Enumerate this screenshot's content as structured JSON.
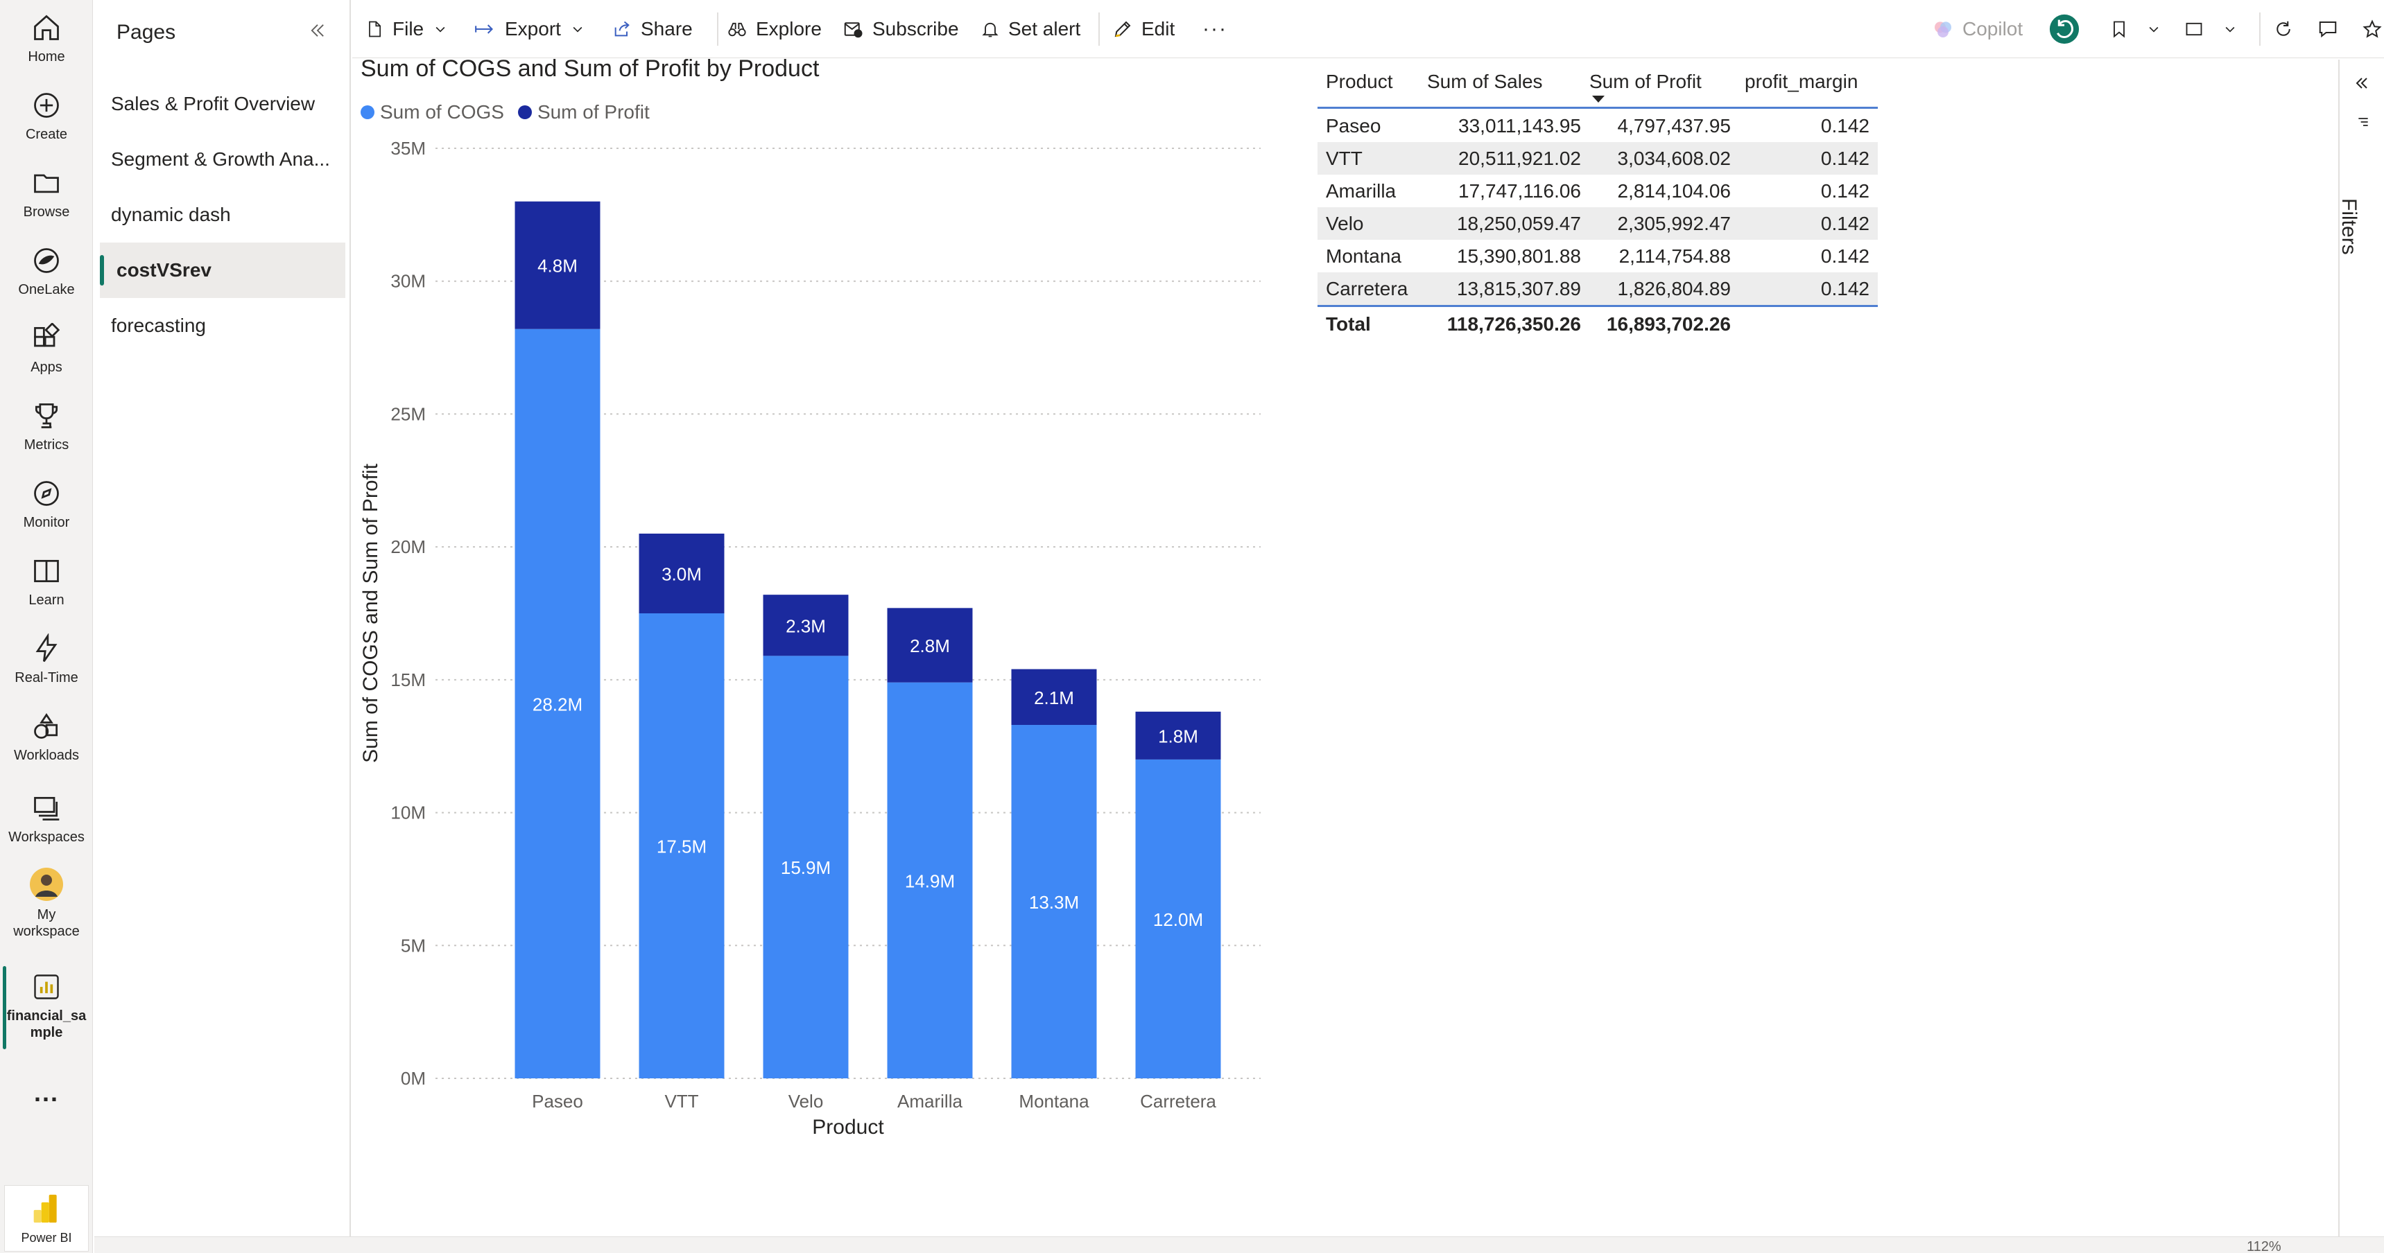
{
  "nav_rail": {
    "items": [
      {
        "label": "Home",
        "icon": "home-icon"
      },
      {
        "label": "Create",
        "icon": "create-icon"
      },
      {
        "label": "Browse",
        "icon": "folder-icon"
      },
      {
        "label": "OneLake",
        "icon": "onelake-icon"
      },
      {
        "label": "Apps",
        "icon": "apps-icon"
      },
      {
        "label": "Metrics",
        "icon": "trophy-icon"
      },
      {
        "label": "Monitor",
        "icon": "compass-icon"
      },
      {
        "label": "Learn",
        "icon": "book-icon"
      },
      {
        "label": "Real-Time",
        "icon": "lightning-icon"
      },
      {
        "label": "Workloads",
        "icon": "shapes-icon"
      },
      {
        "label": "Workspaces",
        "icon": "workspaces-icon"
      },
      {
        "label": "My workspace",
        "icon": "avatar"
      },
      {
        "label": "financial_sample",
        "icon": "report-icon"
      }
    ],
    "more_label": "...",
    "brand_label": "Power BI"
  },
  "pages_panel": {
    "title": "Pages",
    "items": [
      {
        "label": "Sales & Profit Overview",
        "active": false
      },
      {
        "label": "Segment & Growth Ana...",
        "active": false
      },
      {
        "label": "dynamic dash",
        "active": false
      },
      {
        "label": "costVSrev",
        "active": true
      },
      {
        "label": "forecasting",
        "active": false
      }
    ]
  },
  "toolbar": {
    "file": "File",
    "export": "Export",
    "share": "Share",
    "explore": "Explore",
    "subscribe": "Subscribe",
    "set_alert": "Set alert",
    "edit": "Edit",
    "more": "···",
    "copilot": "Copilot"
  },
  "chart_data": {
    "type": "bar",
    "stacked": true,
    "title": "Sum of COGS and Sum of Profit by Product",
    "xlabel": "Product",
    "ylabel": "Sum of COGS and Sum of Profit",
    "categories": [
      "Paseo",
      "VTT",
      "Velo",
      "Amarilla",
      "Montana",
      "Carretera"
    ],
    "series": [
      {
        "name": "Sum of COGS",
        "color": "#3f88f5",
        "values": [
          28.2,
          17.5,
          15.9,
          14.9,
          13.3,
          12.0
        ],
        "labels": [
          "28.2M",
          "17.5M",
          "15.9M",
          "14.9M",
          "13.3M",
          "12.0M"
        ]
      },
      {
        "name": "Sum of Profit",
        "color": "#1b2a9e",
        "values": [
          4.8,
          3.0,
          2.3,
          2.8,
          2.1,
          1.8
        ],
        "labels": [
          "4.8M",
          "3.0M",
          "2.3M",
          "2.8M",
          "2.1M",
          "1.8M"
        ]
      }
    ],
    "yticks": [
      "0M",
      "5M",
      "10M",
      "15M",
      "20M",
      "25M",
      "30M",
      "35M"
    ],
    "ylim": [
      0,
      35
    ],
    "grid": true,
    "legend": "top-left"
  },
  "table": {
    "columns": [
      "Product",
      "Sum of Sales",
      "Sum of Profit",
      "profit_margin"
    ],
    "sorted_column": "Sum of Profit",
    "rows": [
      [
        "Paseo",
        "33,011,143.95",
        "4,797,437.95",
        "0.142"
      ],
      [
        "VTT",
        "20,511,921.02",
        "3,034,608.02",
        "0.142"
      ],
      [
        "Amarilla",
        "17,747,116.06",
        "2,814,104.06",
        "0.142"
      ],
      [
        "Velo",
        "18,250,059.47",
        "2,305,992.47",
        "0.142"
      ],
      [
        "Montana",
        "15,390,801.88",
        "2,114,754.88",
        "0.142"
      ],
      [
        "Carretera",
        "13,815,307.89",
        "1,826,804.89",
        "0.142"
      ]
    ],
    "total": [
      "Total",
      "118,726,350.26",
      "16,893,702.26",
      ""
    ]
  },
  "filters_pane": {
    "label": "Filters"
  },
  "status": {
    "zoom": "112%"
  }
}
